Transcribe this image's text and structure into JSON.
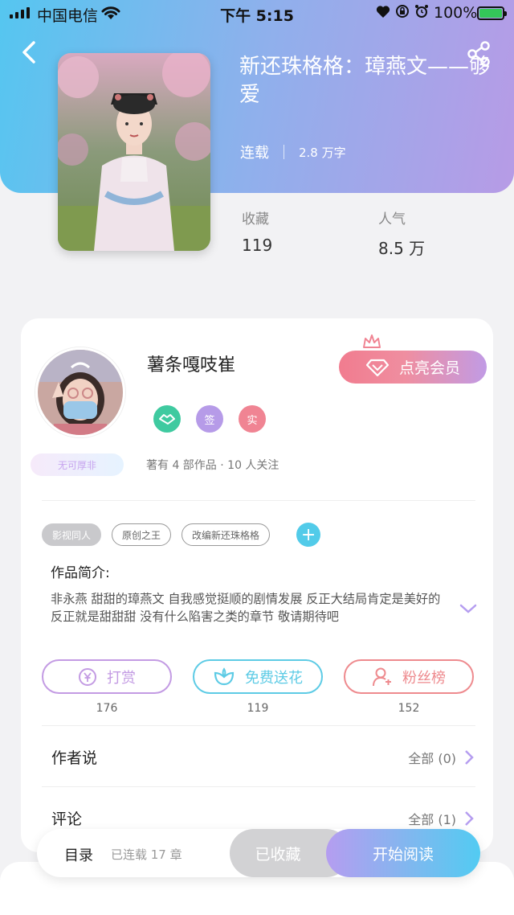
{
  "status_bar": {
    "carrier": "中国电信",
    "time": "下午 5:15",
    "battery": "100%",
    "battery_level": 1.0
  },
  "book": {
    "title": "新还珠格格：璋燕文——够爱",
    "serial_status": "连载",
    "word_count": "2.8 万字",
    "stats": [
      {
        "label": "收藏",
        "value": "119"
      },
      {
        "label": "人气",
        "value": "8.5 万"
      }
    ]
  },
  "author": {
    "name": "薯条嘎吱崔",
    "member_button": "点亮会员",
    "badges": [
      {
        "icon": "handshake-icon",
        "text": "",
        "color": "#3fcaa0"
      },
      {
        "icon": "sign-badge",
        "text": "签",
        "color": "#b69be8"
      },
      {
        "icon": "real-name-badge",
        "text": "实",
        "color": "#f08493"
      }
    ],
    "meta": "著有 4 部作品 · 10 人关注",
    "title_tag": "无可厚非"
  },
  "tags": [
    {
      "label": "影视同人",
      "filled": true
    },
    {
      "label": "原创之王",
      "filled": false
    },
    {
      "label": "改编新还珠格格",
      "filled": false
    }
  ],
  "intro": {
    "label": "作品简介:",
    "text": "非永燕 甜甜的璋燕文 自我感觉挺顺的剧情发展 反正大结局肯定是美好的 反正就是甜甜甜 没有什么陷害之类的章节 敬请期待吧"
  },
  "actions": [
    {
      "label": "打赏",
      "count": "176",
      "icon": "yen-icon",
      "color": "#c39be3"
    },
    {
      "label": "免费送花",
      "count": "119",
      "icon": "flower-icon",
      "color": "#5dcbe5"
    },
    {
      "label": "粉丝榜",
      "count": "152",
      "icon": "user-rank-icon",
      "color": "#ee8a8e"
    }
  ],
  "sections": [
    {
      "title": "作者说",
      "all": "全部 (0)"
    },
    {
      "title": "评论",
      "all": "全部 (1)"
    }
  ],
  "bottom_bar": {
    "toc": "目录",
    "chapters": "已连载 17 章",
    "collected": "已收藏",
    "start_reading": "开始阅读"
  }
}
